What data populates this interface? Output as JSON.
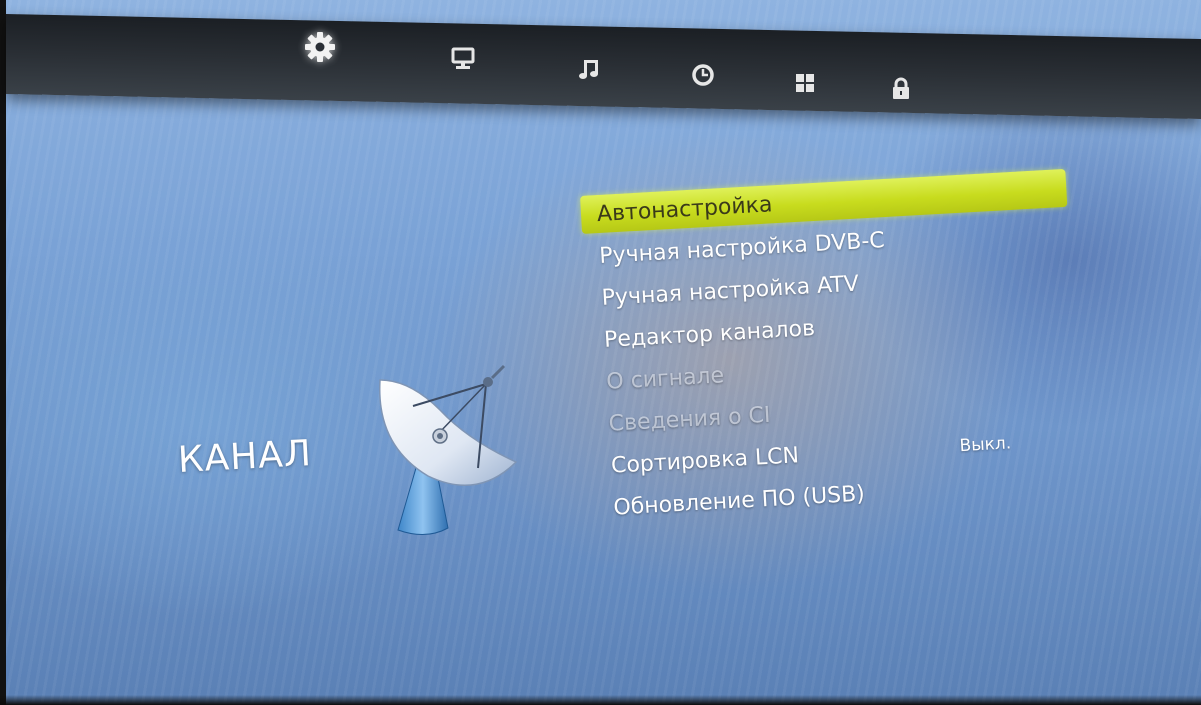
{
  "topbar": {
    "icons": [
      {
        "name": "gear-icon",
        "active": true
      },
      {
        "name": "monitor-icon",
        "active": false
      },
      {
        "name": "music-note-icon",
        "active": false
      },
      {
        "name": "clock-icon",
        "active": false
      },
      {
        "name": "grid-icon",
        "active": false
      },
      {
        "name": "lock-icon",
        "active": false
      }
    ]
  },
  "category": {
    "label": "КАНАЛ",
    "icon": "satellite-dish-icon"
  },
  "menu": {
    "items": [
      {
        "label": "Автонастройка",
        "state": "selected"
      },
      {
        "label": "Ручная настройка DVB-C",
        "state": "enabled"
      },
      {
        "label": "Ручная настройка ATV",
        "state": "enabled"
      },
      {
        "label": "Редактор каналов",
        "state": "enabled"
      },
      {
        "label": "О сигнале",
        "state": "disabled"
      },
      {
        "label": "Сведения о CI",
        "state": "disabled"
      },
      {
        "label": "Сортировка LCN",
        "state": "enabled",
        "value": "Выкл."
      },
      {
        "label": "Обновление ПО (USB)",
        "state": "enabled"
      }
    ]
  },
  "colors": {
    "highlight": "#cfe22a",
    "text": "#ffffff",
    "topbar": "#2a2f35"
  }
}
